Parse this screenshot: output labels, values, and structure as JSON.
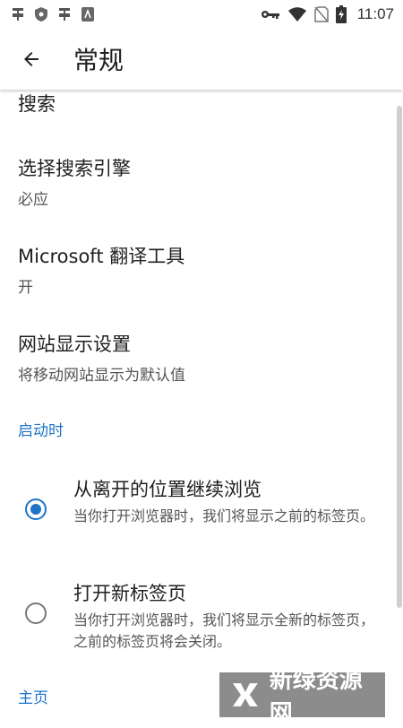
{
  "status_bar": {
    "time": "11:07",
    "icons_left": [
      "bug-icon",
      "shield-icon",
      "bug-icon",
      "document-icon"
    ],
    "icons_right": [
      "key-icon",
      "wifi-icon",
      "no-sim-icon",
      "battery-charging-icon"
    ]
  },
  "app_bar": {
    "back_icon": "arrow-left-icon",
    "title": "常规"
  },
  "settings": {
    "search_section_partial": "搜索",
    "search_engine": {
      "title": "选择搜索引擎",
      "value": "必应"
    },
    "translator": {
      "title": "Microsoft 翻译工具",
      "value": "开"
    },
    "site_display": {
      "title": "网站显示设置",
      "value": "将移动网站显示为默认值"
    }
  },
  "startup": {
    "header": "启动时",
    "options": [
      {
        "title": "从离开的位置继续浏览",
        "description": "当你打开浏览器时，我们将显示之前的标签页。",
        "selected": true
      },
      {
        "title": "打开新标签页",
        "description": "当你打开浏览器时，我们将显示全新的标签页，之前的标签页将会关闭。",
        "selected": false
      }
    ]
  },
  "home_section": {
    "header": "主页"
  },
  "watermark": {
    "text": "新绿资源网"
  },
  "colors": {
    "accent": "#1e73c8",
    "text_primary": "#202020",
    "text_secondary": "#555555"
  }
}
